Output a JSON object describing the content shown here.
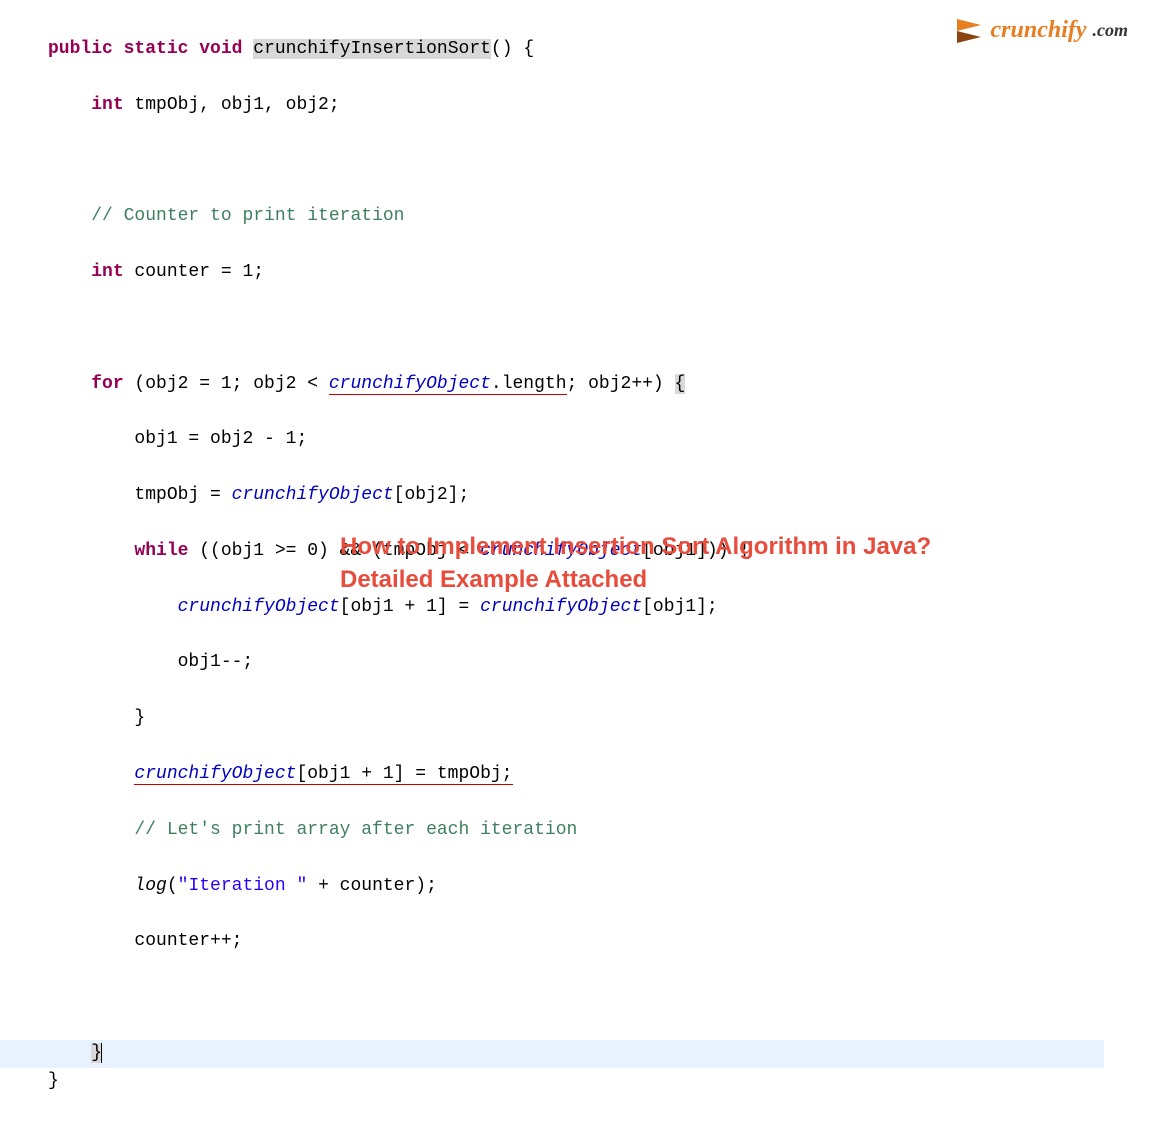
{
  "logo": {
    "brand": "crunchify",
    "tld": ".com"
  },
  "overlay": {
    "line1": "How to Implement Insertion Sort Algorithm in Java?",
    "line2": "Detailed Example Attached"
  },
  "code": {
    "l1_kw1": "public",
    "l1_kw2": "static",
    "l1_kw3": "void",
    "l1_method": "crunchifyInsertionSort",
    "l1_rest": "() {",
    "l2_kw": "int",
    "l2_rest": " tmpObj, obj1, obj2;",
    "l4_comment": "// Counter to print iteration",
    "l5_kw": "int",
    "l5_rest": " counter = 1;",
    "l7_kw": "for",
    "l7_a": " (obj2 = 1; obj2 < ",
    "l7_field": "crunchifyObject",
    "l7_b": ".length",
    "l7_c": "; obj2++) ",
    "l7_brace": "{",
    "l8": "obj1 = obj2 - 1;",
    "l9_a": "tmpObj = ",
    "l9_field": "crunchifyObject",
    "l9_b": "[obj2];",
    "l10_kw": "while",
    "l10_a": " ((obj1 >= 0) && (tmpObj < ",
    "l10_field": "crunchifyObject",
    "l10_b": "[obj1])) {",
    "l11_field1": "crunchifyObject",
    "l11_a": "[obj1 + 1] = ",
    "l11_field2": "crunchifyObject",
    "l11_b": "[obj1];",
    "l12": "obj1--;",
    "l13": "}",
    "l14_field": "crunchifyObject",
    "l14_a": "[obj1 + 1] = tmpObj;",
    "l15_comment": "// Let's print array after each iteration",
    "l16_method": "log",
    "l16_a": "(",
    "l16_str": "\"Iteration \"",
    "l16_b": " + counter);",
    "l17": "counter++;",
    "l19": "}",
    "l20": "}"
  }
}
